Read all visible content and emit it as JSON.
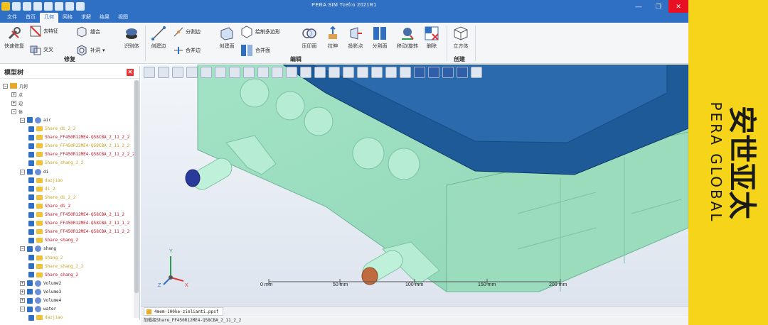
{
  "window": {
    "title": "PERA SIM Tcefro 2021R1",
    "min": "—",
    "max": "❐",
    "close": "✕"
  },
  "tabs": [
    "文件",
    "首页",
    "几何",
    "网格",
    "求解",
    "结果",
    "视图"
  ],
  "active_tab": "几何",
  "ribbon": {
    "groups": [
      {
        "label": "修复",
        "buttons": [
          {
            "id": "quick-repair",
            "label": "快速修复",
            "icon": "wrench-icon"
          },
          {
            "id": "remove-feature",
            "label": "去特征",
            "icon": "eraser-icon"
          },
          {
            "id": "intersect",
            "label": "交叉",
            "icon": "intersect-icon"
          },
          {
            "id": "stitch",
            "label": "缝合",
            "icon": "stitch-icon"
          },
          {
            "id": "patch",
            "label": "补洞",
            "icon": "patch-icon"
          },
          {
            "id": "identify-body",
            "label": "识别体",
            "icon": "identify-body-icon"
          }
        ]
      },
      {
        "label": "编辑",
        "buttons": [
          {
            "id": "create-edge",
            "label": "创建边",
            "icon": "line-icon"
          },
          {
            "id": "split-edge",
            "label": "分割边",
            "icon": "split-edge-icon"
          },
          {
            "id": "merge-edge",
            "label": "合并边",
            "icon": "merge-edge-icon"
          },
          {
            "id": "create-face",
            "label": "创建面",
            "icon": "face-icon"
          },
          {
            "id": "draw-polygon",
            "label": "绘制多边形",
            "icon": "polygon-icon"
          },
          {
            "id": "merge-face",
            "label": "合并面",
            "icon": "merge-face-icon"
          },
          {
            "id": "imprint-face",
            "label": "压印面",
            "icon": "imprint-icon"
          },
          {
            "id": "extrude",
            "label": "拉伸",
            "icon": "extrude-icon"
          },
          {
            "id": "project-point",
            "label": "投影点",
            "icon": "project-icon"
          },
          {
            "id": "split-face",
            "label": "分割面",
            "icon": "split-face-icon"
          },
          {
            "id": "move-rotate",
            "label": "移动/旋转",
            "icon": "move-icon"
          },
          {
            "id": "delete",
            "label": "删除",
            "icon": "delete-icon"
          }
        ]
      },
      {
        "label": "创建",
        "buttons": [
          {
            "id": "cube",
            "label": "立方体",
            "icon": "cube-icon"
          }
        ]
      }
    ]
  },
  "model_tree": {
    "title": "模型树",
    "nodes": [
      {
        "depth": 0,
        "text": "几何",
        "kind": "folder",
        "tog": "−"
      },
      {
        "depth": 1,
        "text": "点",
        "kind": "none",
        "tog": "+"
      },
      {
        "depth": 1,
        "text": "边",
        "kind": "none",
        "tog": "+"
      },
      {
        "depth": 1,
        "text": "体",
        "kind": "none",
        "tog": "−"
      },
      {
        "depth": 2,
        "text": "air",
        "kind": "group",
        "tog": "−"
      },
      {
        "depth": 3,
        "text": "Share_di_2_2",
        "kind": "face",
        "color": "yel"
      },
      {
        "depth": 3,
        "text": "Share_FF450R12ME4-Q58CBA_2_11_2_2",
        "kind": "face",
        "color": "red"
      },
      {
        "depth": 3,
        "text": "Share_FF450R12ME4-Q58CBA_2_11_2_2",
        "kind": "face",
        "color": "yel"
      },
      {
        "depth": 3,
        "text": "Share_FF450R12ME4-Q58CBA_2_11_2_2_2",
        "kind": "face",
        "color": "red"
      },
      {
        "depth": 3,
        "text": "Share_shang_2_2",
        "kind": "face",
        "color": "yel"
      },
      {
        "depth": 2,
        "text": "di",
        "kind": "group",
        "tog": "−"
      },
      {
        "depth": 3,
        "text": "dazjiao",
        "kind": "face",
        "color": "yel"
      },
      {
        "depth": 3,
        "text": "di_2",
        "kind": "face",
        "color": "yel"
      },
      {
        "depth": 3,
        "text": "Share_di_2_2",
        "kind": "face",
        "color": "yel"
      },
      {
        "depth": 3,
        "text": "Share_di_2",
        "kind": "face",
        "color": "red"
      },
      {
        "depth": 3,
        "text": "Share_FF450R12ME4-Q58CBA_2_11_2",
        "kind": "face",
        "color": "red"
      },
      {
        "depth": 3,
        "text": "Share_FF450R12ME4-Q58CBA_2_11_1_2",
        "kind": "face",
        "color": "red"
      },
      {
        "depth": 3,
        "text": "Share_FF450R12ME4-Q58CBA_2_11_2_2",
        "kind": "face",
        "color": "red"
      },
      {
        "depth": 3,
        "text": "Share_shang_2",
        "kind": "face",
        "color": "red"
      },
      {
        "depth": 2,
        "text": "shang",
        "kind": "group",
        "tog": "−"
      },
      {
        "depth": 3,
        "text": "shang_2",
        "kind": "face",
        "color": "yel"
      },
      {
        "depth": 3,
        "text": "Share_shang_2_2",
        "kind": "face",
        "color": "yel"
      },
      {
        "depth": 3,
        "text": "Share_shang_2",
        "kind": "face",
        "color": "red"
      },
      {
        "depth": 2,
        "text": "Volume2",
        "kind": "group",
        "tog": "+"
      },
      {
        "depth": 2,
        "text": "Volume3",
        "kind": "group",
        "tog": "+"
      },
      {
        "depth": 2,
        "text": "Volume4",
        "kind": "group",
        "tog": "+"
      },
      {
        "depth": 2,
        "text": "water",
        "kind": "group",
        "tog": "−"
      },
      {
        "depth": 3,
        "text": "dazjiao",
        "kind": "face",
        "color": "yel"
      }
    ]
  },
  "viewport": {
    "axes": {
      "x": "X",
      "y": "Y",
      "z": "Z"
    },
    "scale": {
      "labels": [
        "0 mm",
        "50 mm",
        "100 mm",
        "150 mm",
        "200 mm"
      ]
    }
  },
  "doc_tab": "4mem-100ke-zielianti.ppsf",
  "status": "加载组Share_FF450R12ME4-Q58CBA_2_11_2_2",
  "brand": {
    "cn": "安世亚太",
    "en": "PERA GLOBAL"
  },
  "colors": {
    "accent": "#2f6fc4",
    "model_body": "#a7e6c8",
    "model_top": "#1f5a98",
    "brand_yellow": "#f6d41a",
    "close_red": "#e81123"
  }
}
